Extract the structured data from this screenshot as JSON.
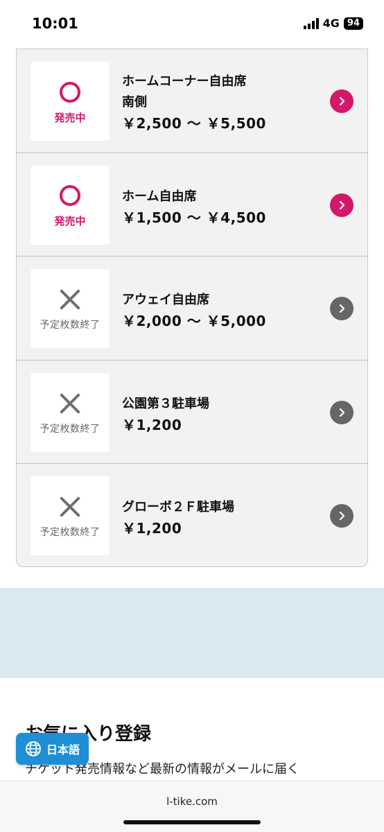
{
  "status_bar": {
    "time": "10:01",
    "network": "4G",
    "battery": "94"
  },
  "tickets": [
    {
      "status_label": "発売中",
      "status_type": "on",
      "name_lines": [
        "ホームコーナー自由席",
        "南側"
      ],
      "price": "￥2,500 ～ ￥5,500"
    },
    {
      "status_label": "発売中",
      "status_type": "on",
      "name_lines": [
        "ホーム自由席"
      ],
      "price": "￥1,500 ～ ￥4,500"
    },
    {
      "status_label": "予定枚数終了",
      "status_type": "off",
      "name_lines": [
        "アウェイ自由席"
      ],
      "price": "￥2,000 ～ ￥5,000"
    },
    {
      "status_label": "予定枚数終了",
      "status_type": "off",
      "name_lines": [
        "公園第３駐車場"
      ],
      "price": "￥1,200"
    },
    {
      "status_label": "予定枚数終了",
      "status_type": "off",
      "name_lines": [
        "グローボ２Ｆ駐車場"
      ],
      "price": "￥1,200"
    }
  ],
  "favorites": {
    "title": "お気に入り登録",
    "description": "チケット発売情報など最新の情報がメールに届く"
  },
  "language_button": {
    "label": "日本語"
  },
  "browser": {
    "url": "l-tike.com"
  },
  "colors": {
    "on_sale": "#d5176a",
    "sold_out": "#666666",
    "language_button": "#1e8fd6",
    "band": "#dbe9f3"
  },
  "icons": {
    "on_sale": "circle-icon",
    "sold_out": "cross-icon",
    "arrow": "chevron-right-icon",
    "language": "globe-icon"
  }
}
